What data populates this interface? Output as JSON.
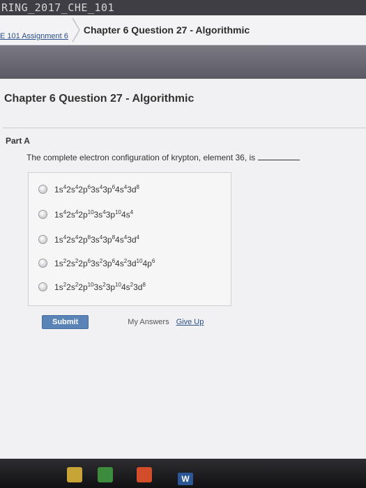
{
  "top_tab": "RING_2017_CHE_101",
  "breadcrumb": {
    "parent": "E 101 Assignment 6",
    "current": "Chapter 6 Question 27 - Algorithmic"
  },
  "page": {
    "title": "Chapter 6 Question 27 - Algorithmic",
    "part_label": "Part A",
    "question": "The complete electron configuration of krypton, element 36, is"
  },
  "options": [
    [
      [
        "1s",
        "4"
      ],
      [
        "2s",
        "4"
      ],
      [
        "2p",
        "6"
      ],
      [
        "3s",
        "4"
      ],
      [
        "3p",
        "6"
      ],
      [
        "4s",
        "4"
      ],
      [
        "3d",
        "8"
      ]
    ],
    [
      [
        "1s",
        "4"
      ],
      [
        "2s",
        "4"
      ],
      [
        "2p",
        "10"
      ],
      [
        "3s",
        "4"
      ],
      [
        "3p",
        "10"
      ],
      [
        "4s",
        "4"
      ]
    ],
    [
      [
        "1s",
        "4"
      ],
      [
        "2s",
        "4"
      ],
      [
        "2p",
        "8"
      ],
      [
        "3s",
        "4"
      ],
      [
        "3p",
        "8"
      ],
      [
        "4s",
        "4"
      ],
      [
        "3d",
        "4"
      ]
    ],
    [
      [
        "1s",
        "2"
      ],
      [
        "2s",
        "2"
      ],
      [
        "2p",
        "6"
      ],
      [
        "3s",
        "2"
      ],
      [
        "3p",
        "6"
      ],
      [
        "4s",
        "2"
      ],
      [
        "3d",
        "10"
      ],
      [
        "4p",
        "6"
      ]
    ],
    [
      [
        "1s",
        "2"
      ],
      [
        "2s",
        "2"
      ],
      [
        "2p",
        "10"
      ],
      [
        "3s",
        "2"
      ],
      [
        "3p",
        "10"
      ],
      [
        "4s",
        "2"
      ],
      [
        "3d",
        "8"
      ]
    ]
  ],
  "actions": {
    "submit": "Submit",
    "my_answers": "My Answers",
    "give_up": "Give Up"
  },
  "taskbar": {
    "word_icon_letter": "W"
  }
}
